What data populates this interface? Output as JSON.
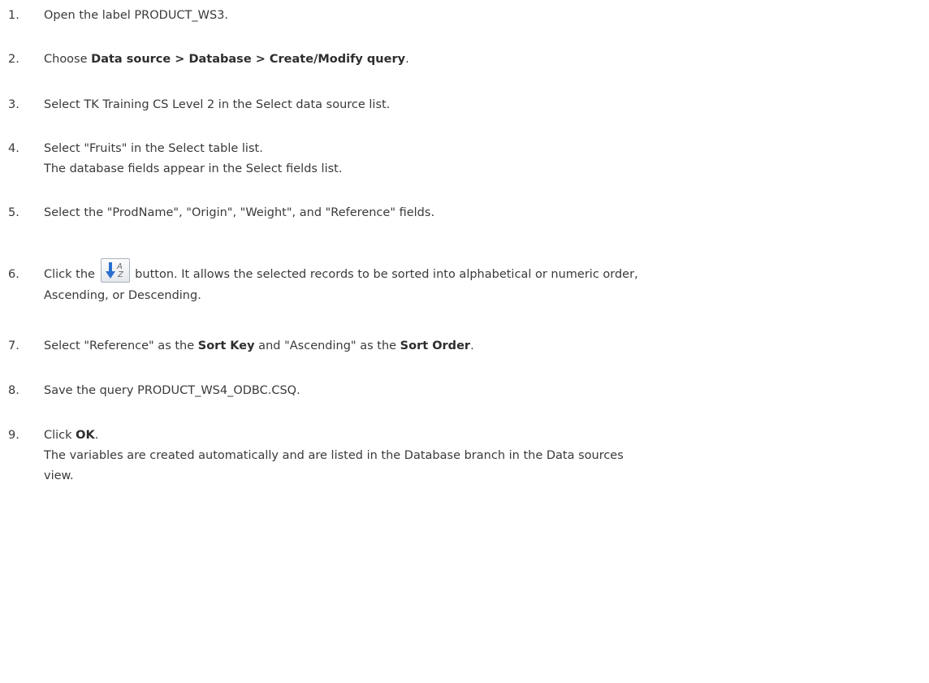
{
  "steps": [
    {
      "num": "1.",
      "line1": [
        "Open the label PRODUCT_WS3."
      ]
    },
    {
      "num": "2.",
      "line1": [
        "Choose ",
        "Data source > Database > Create/Modify query",
        "."
      ]
    },
    {
      "num": "3.",
      "line1": [
        "Select TK Training CS Level 2 in the Select data source list."
      ]
    },
    {
      "num": "4.",
      "line1": [
        "Select \"Fruits\" in the Select table list."
      ],
      "line2": "The database fields appear in the Select fields list."
    },
    {
      "num": "5.",
      "line1": [
        "Select the \"ProdName\", \"Origin\", \"Weight\", and \"Reference\" fields."
      ]
    },
    {
      "num": "6.",
      "line1": [
        "Click the ",
        " button. It allows the selected records to be sorted into alphabetical or numeric order,"
      ],
      "line2": "Ascending, or Descending.",
      "icon": "sort-ascending-az-icon"
    },
    {
      "num": "7.",
      "line1": [
        "Select \"Reference\" as the ",
        "Sort Key",
        " and \"Ascending\" as the ",
        "Sort Order",
        "."
      ]
    },
    {
      "num": "8.",
      "line1": [
        "Save the query PRODUCT_WS4_ODBC.CSQ."
      ]
    },
    {
      "num": "9.",
      "line1": [
        "Click ",
        "OK",
        "."
      ],
      "line2": "The variables are created automatically and are listed in the Database branch in the Data sources",
      "line3": "view."
    }
  ],
  "colors": {
    "text": "#3a3a3a",
    "icon_arrow": "#2a6fd0",
    "icon_letters": "#6a6a6a"
  }
}
